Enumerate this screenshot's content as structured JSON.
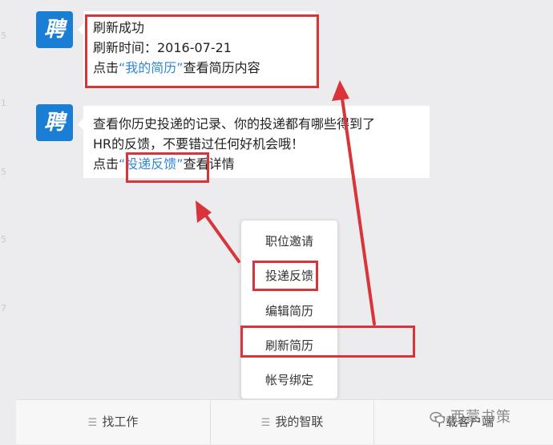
{
  "messages": [
    {
      "avatar_char": "聘",
      "lines": [
        "刷新成功",
        "刷新时间：2016-07-21"
      ],
      "action_prefix": "点击",
      "link_text": "“我的简历”",
      "action_suffix": "查看简历内容"
    },
    {
      "avatar_char": "聘",
      "lines": [
        "查看你历史投递的记录、你的投递都有哪些得到了",
        "HR的反馈，不要错过任何好机会哦！"
      ],
      "action_prefix": "点击",
      "link_text": "“投递反馈”",
      "action_suffix": "查看详情"
    }
  ],
  "menu": {
    "items": [
      "职位邀请",
      "投递反馈",
      "编辑简历",
      "刷新简历",
      "帐号绑定"
    ],
    "highlighted": [
      "投递反馈",
      "刷新简历"
    ]
  },
  "tabbar": {
    "tabs": [
      "找工作",
      "我的智联",
      "下载客户端"
    ]
  },
  "watermark": {
    "text": "西蒙书策"
  },
  "annotation": {
    "color": "#d8343a"
  },
  "colors": {
    "link": "#2f86d6",
    "avatar": "#1a7fd4"
  }
}
